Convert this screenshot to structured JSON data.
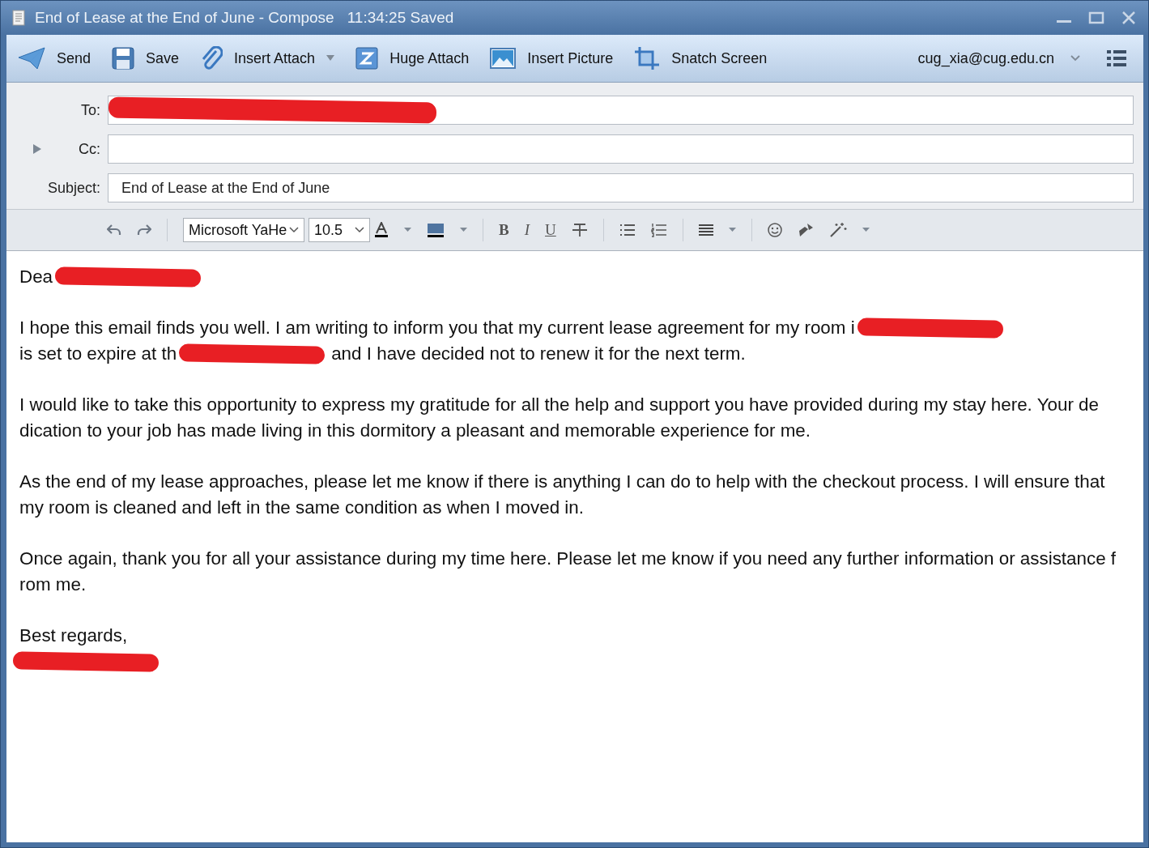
{
  "window": {
    "title": "End of Lease at the End of June - Compose",
    "saved": "11:34:25 Saved"
  },
  "toolbar": [
    {
      "kind": "send",
      "label": "Send",
      "dropdown": false
    },
    {
      "kind": "save",
      "label": "Save",
      "dropdown": false
    },
    {
      "kind": "attach",
      "label": "Insert Attach",
      "dropdown": true
    },
    {
      "kind": "huge",
      "label": "Huge Attach",
      "dropdown": false
    },
    {
      "kind": "picture",
      "label": "Insert Picture",
      "dropdown": false
    },
    {
      "kind": "snatch",
      "label": "Snatch Screen",
      "dropdown": false
    }
  ],
  "account": "cug_xia@cug.edu.cn",
  "fields": [
    {
      "label": "To:",
      "redacted": true,
      "expander": false
    },
    {
      "label": "Cc:",
      "redacted": false,
      "expander": true
    },
    {
      "label": "Subject:",
      "value": "End of Lease at the End of June",
      "redacted": false,
      "expander": false
    }
  ],
  "format": {
    "font": "Microsoft YaHe",
    "size": "10.5",
    "bold": "B",
    "italic": "I",
    "underline": "U"
  },
  "body": [
    [
      [
        {
          "kind": "text",
          "text": "Dea"
        },
        {
          "kind": "redaction"
        }
      ]
    ],
    [
      [
        {
          "kind": "text",
          "text": "I hope this email finds you well. I am writing to inform you that my current lease agreement for my room i"
        },
        {
          "kind": "redaction"
        }
      ],
      [
        {
          "kind": "text",
          "text": "is set to expire at th"
        },
        {
          "kind": "redaction"
        },
        {
          "kind": "text",
          "text": "and I have decided not to renew it for the next term."
        }
      ]
    ],
    [
      [
        {
          "kind": "text",
          "text": "I would like to take this opportunity to express my gratitude for all the help and support you have provided during my stay here. Your de"
        }
      ],
      [
        {
          "kind": "text",
          "text": "dication to your job has made living in this dormitory a pleasant and memorable experience for me."
        }
      ]
    ],
    [
      [
        {
          "kind": "text",
          "text": "As the end of my lease approaches, please let me know if there is anything I can do to help with the checkout process. I will ensure that"
        }
      ],
      [
        {
          "kind": "text",
          "text": "my room is cleaned and left in the same condition as when I moved in."
        }
      ]
    ],
    [
      [
        {
          "kind": "text",
          "text": "Once again, thank you for all your assistance during my time here. Please let me know if you need any further information or assistance f"
        }
      ],
      [
        {
          "kind": "text",
          "text": "rom me."
        }
      ]
    ],
    [
      [
        {
          "kind": "text",
          "text": "Best regards,"
        }
      ],
      [
        {
          "kind": "redaction"
        }
      ]
    ]
  ]
}
